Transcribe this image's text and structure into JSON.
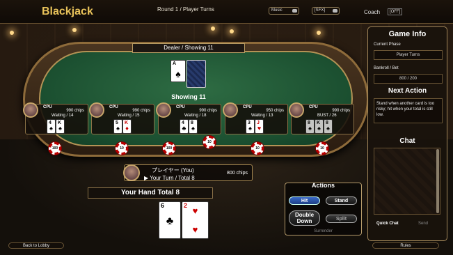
{
  "header": {
    "title": "Blackjack",
    "round": "Round 1 / Player Turns",
    "music": "Music",
    "sfx": "SFX",
    "coach": "Coach",
    "coach_state": "[OFF]"
  },
  "dealer": {
    "banner": "Dealer / Showing 11",
    "total": "Showing 11",
    "up_card": {
      "rank": "A",
      "suit": "♠"
    }
  },
  "seats": [
    {
      "name": "CPU",
      "chips": "990 chips",
      "status": "Waiting / 14",
      "bet": "100",
      "cards": [
        {
          "rank": "4",
          "suit": "♠"
        },
        {
          "rank": "K",
          "suit": "♠"
        }
      ]
    },
    {
      "name": "CPU",
      "chips": "990 chips",
      "status": "Waiting / 15",
      "bet": "10",
      "cards": [
        {
          "rank": "5",
          "suit": "♠"
        },
        {
          "rank": "K",
          "suit": "♦"
        }
      ]
    },
    {
      "name": "CPU",
      "chips": "990 chips",
      "status": "Waiting / 18",
      "bet": "100",
      "cards": [
        {
          "rank": "4",
          "suit": "♣"
        },
        {
          "rank": "8",
          "suit": "♠"
        }
      ]
    },
    {
      "name": "CPU",
      "chips": "950 chips",
      "status": "Waiting / 13",
      "bet": "10",
      "cards": [
        {
          "rank": "3",
          "suit": "♠"
        },
        {
          "rank": "J",
          "suit": "♥"
        }
      ]
    },
    {
      "name": "CPU",
      "chips": "990 chips",
      "status": "BUST / 26",
      "bet": "10",
      "cards": [
        {
          "rank": "8",
          "suit": "♠"
        },
        {
          "rank": "K",
          "suit": "♠"
        },
        {
          "rank": "8",
          "suit": "♠"
        }
      ]
    }
  ],
  "table_chip": "10",
  "player": {
    "name": "プレイヤー (You)",
    "chips": "800 chips",
    "turn": "▶ Your Turn / Total 8",
    "bet": "100"
  },
  "hand": {
    "label": "Your Hand  Total 8",
    "cards": [
      {
        "rank": "6",
        "suit": "♣"
      },
      {
        "rank": "2",
        "suit": "♥"
      }
    ]
  },
  "actions": {
    "title": "Actions",
    "hit": "Hit",
    "stand": "Stand",
    "double": "Double Down",
    "split": "Split",
    "surrender": "Surrender"
  },
  "panel": {
    "game_info": "Game Info",
    "phase_label": "Current Phase",
    "phase": "Player Turns",
    "bankroll_label": "Bankroll / Bet",
    "bankroll": "800 / 200",
    "next_action": "Next Action",
    "advice": "Stand when another card is too risky; hit when your total is still low.",
    "chat": "Chat",
    "quick_chat": "Quick Chat",
    "send": "Send"
  },
  "footer": {
    "back": "Back to Lobby",
    "rules": "Rules"
  },
  "colors": {
    "felt": "#1b4f30",
    "gold": "#e8c25a",
    "chip_red": "#b00000",
    "primary": "#2c55a8"
  }
}
